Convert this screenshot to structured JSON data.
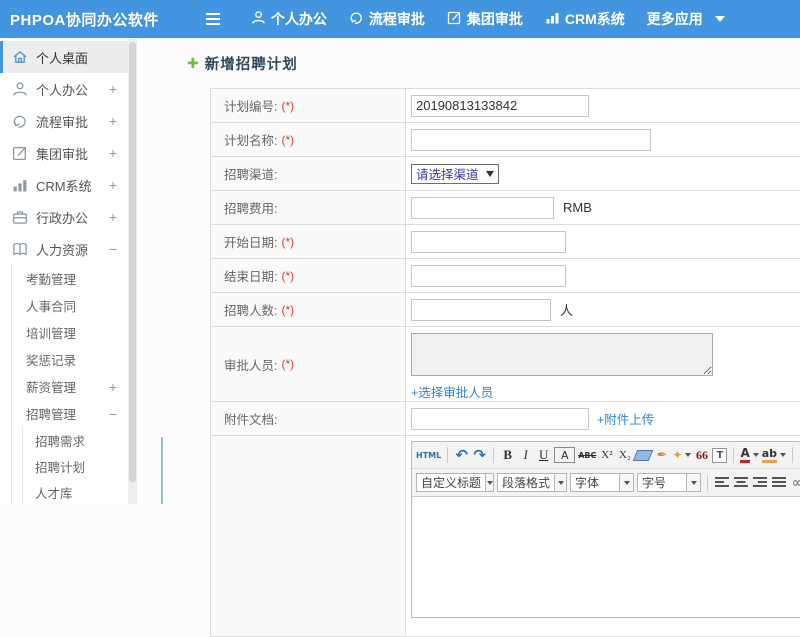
{
  "header": {
    "brand": "PHPOA协同办公软件",
    "menu": [
      {
        "label": "个人办公"
      },
      {
        "label": "流程审批"
      },
      {
        "label": "集团审批"
      },
      {
        "label": "CRM系统"
      },
      {
        "label": "更多应用"
      }
    ]
  },
  "sidebar": {
    "items": [
      {
        "label": "个人桌面",
        "toggle": ""
      },
      {
        "label": "个人办公",
        "toggle": "+"
      },
      {
        "label": "流程审批",
        "toggle": "+"
      },
      {
        "label": "集团审批",
        "toggle": "+"
      },
      {
        "label": "CRM系统",
        "toggle": "+"
      },
      {
        "label": "行政办公",
        "toggle": "+"
      },
      {
        "label": "人力资源",
        "toggle": "−"
      }
    ],
    "hr_submenu": [
      {
        "label": "考勤管理",
        "toggle": ""
      },
      {
        "label": "人事合同",
        "toggle": ""
      },
      {
        "label": "培训管理",
        "toggle": ""
      },
      {
        "label": "奖惩记录",
        "toggle": ""
      },
      {
        "label": "薪资管理",
        "toggle": "+"
      },
      {
        "label": "招聘管理",
        "toggle": "−"
      }
    ],
    "recruit_submenu": [
      {
        "label": "招聘需求"
      },
      {
        "label": "招聘计划"
      },
      {
        "label": "人才库"
      }
    ]
  },
  "main": {
    "title": "新增招聘计划",
    "form": {
      "rows": [
        {
          "label": "计划编号:",
          "required": "(*)",
          "value": "20190813133842"
        },
        {
          "label": "计划名称:",
          "required": "(*)",
          "value": ""
        },
        {
          "label": "招聘渠道:",
          "required": "",
          "select_value": "请选择渠道"
        },
        {
          "label": "招聘费用:",
          "required": "",
          "value": "",
          "suffix": "RMB"
        },
        {
          "label": "开始日期:",
          "required": "(*)",
          "value": ""
        },
        {
          "label": "结束日期:",
          "required": "(*)",
          "value": ""
        },
        {
          "label": "招聘人数:",
          "required": "(*)",
          "value": "",
          "suffix": "人"
        },
        {
          "label": "审批人员:",
          "required": "(*)",
          "textarea_value": "",
          "link": "+选择审批人员"
        },
        {
          "label": "附件文档:",
          "required": "",
          "value": "",
          "link": "+附件上传"
        }
      ]
    },
    "editor": {
      "toolbar_row1": [
        {
          "name": "html-source",
          "glyph": "HTML"
        },
        {
          "name": "undo",
          "glyph": "↶"
        },
        {
          "name": "redo",
          "glyph": "↷"
        },
        {
          "name": "bold",
          "glyph": "B"
        },
        {
          "name": "italic",
          "glyph": "I"
        },
        {
          "name": "underline",
          "glyph": "U"
        },
        {
          "name": "font-box",
          "glyph": "A"
        },
        {
          "name": "strikethrough",
          "glyph": "ABC"
        },
        {
          "name": "superscript",
          "glyph": "X²"
        },
        {
          "name": "subscript",
          "glyph": "X₂"
        },
        {
          "name": "remove-format",
          "glyph": ""
        },
        {
          "name": "format-brush",
          "glyph": "✒"
        },
        {
          "name": "magic-fill",
          "glyph": "✦"
        },
        {
          "name": "blockquote",
          "glyph": "66"
        },
        {
          "name": "paste-as-text",
          "glyph": "T"
        },
        {
          "name": "font-color",
          "glyph": "A"
        },
        {
          "name": "highlight",
          "glyph": "ab"
        }
      ],
      "toolbar_row2_selects": [
        {
          "label": "自定义标题"
        },
        {
          "label": "段落格式"
        },
        {
          "label": "字体"
        },
        {
          "label": "字号"
        }
      ],
      "link_glyph": "∞"
    }
  }
}
